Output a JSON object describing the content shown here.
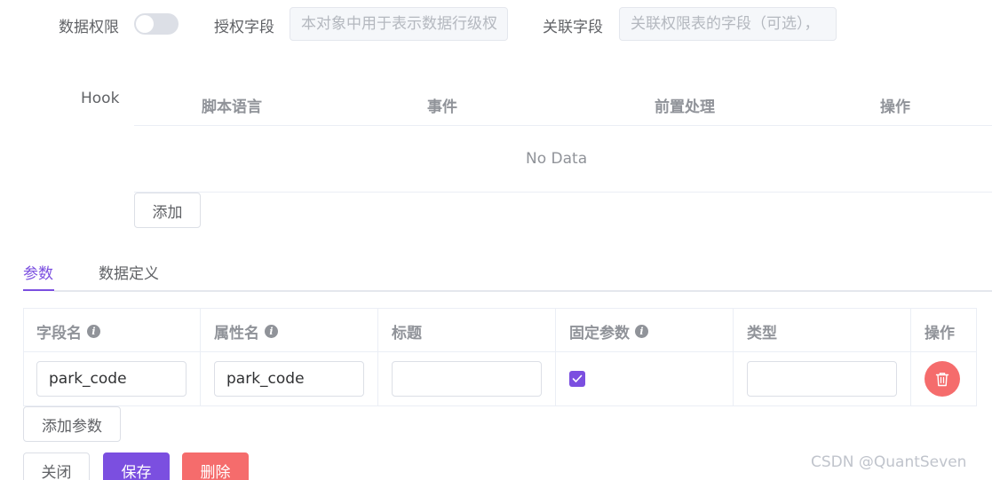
{
  "top_row": {
    "data_permission_label": "数据权限",
    "data_permission_on": false,
    "auth_field_label": "授权字段",
    "auth_field_placeholder": "本对象中用于表示数据行级杈",
    "link_field_label": "关联字段",
    "link_field_placeholder": "关联权限表的字段（可选），"
  },
  "hook": {
    "label": "Hook",
    "columns": [
      "脚本语言",
      "事件",
      "前置处理",
      "操作"
    ],
    "empty_text": "No Data",
    "add_label": "添加"
  },
  "tabs": [
    {
      "label": "参数",
      "active": true
    },
    {
      "label": "数据定义",
      "active": false
    }
  ],
  "params": {
    "columns": [
      {
        "label": "字段名",
        "info": true
      },
      {
        "label": "属性名",
        "info": true
      },
      {
        "label": "标题",
        "info": false
      },
      {
        "label": "固定参数",
        "info": true
      },
      {
        "label": "类型",
        "info": false
      },
      {
        "label": "操作",
        "info": false
      }
    ],
    "info_glyph": "i",
    "rows": [
      {
        "field_name": "park_code",
        "attr_name": "park_code",
        "title": "",
        "fixed": true,
        "type": ""
      }
    ],
    "add_param_label": "添加参数"
  },
  "footer": {
    "close_label": "关闭",
    "save_label": "保存",
    "delete_label": "删除"
  },
  "watermark": "CSDN @QuantSeven",
  "colors": {
    "accent": "#7b4fe0",
    "danger": "#f56c6c",
    "border": "#ebeef5"
  }
}
